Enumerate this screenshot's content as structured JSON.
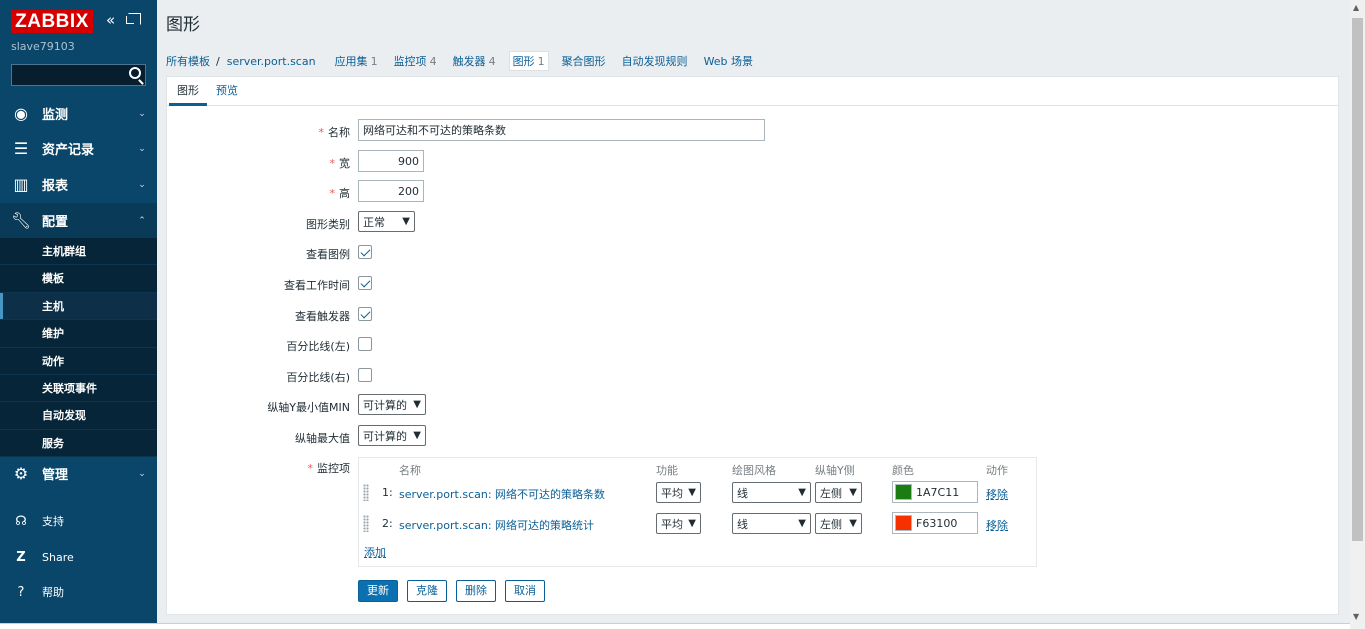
{
  "app": {
    "logo": "ZABBIX",
    "server_name": "slave79103"
  },
  "sidebar": {
    "search_placeholder": "",
    "menu": [
      {
        "label": "监测",
        "icon": "eye-icon"
      },
      {
        "label": "资产记录",
        "icon": "list-icon"
      },
      {
        "label": "报表",
        "icon": "bar-chart-icon"
      },
      {
        "label": "配置",
        "icon": "wrench-icon"
      }
    ],
    "config_submenu": [
      "主机群组",
      "模板",
      "主机",
      "维护",
      "动作",
      "关联项事件",
      "自动发现",
      "服务"
    ],
    "admin": {
      "label": "管理"
    },
    "support": "支持",
    "share": "Share",
    "help": "帮助"
  },
  "page": {
    "title": "图形"
  },
  "breadcrumbs": {
    "all_templates": "所有模板",
    "separator": "/",
    "host": "server.port.scan",
    "tabs": [
      {
        "label": "应用集",
        "count": "1"
      },
      {
        "label": "监控项",
        "count": "4"
      },
      {
        "label": "触发器",
        "count": "4"
      },
      {
        "label": "图形",
        "count": "1"
      },
      {
        "label": "聚合图形",
        "count": ""
      },
      {
        "label": "自动发现规则",
        "count": ""
      },
      {
        "label": "Web 场景",
        "count": ""
      }
    ]
  },
  "form_tabs": {
    "graph": "图形",
    "preview": "预览"
  },
  "form": {
    "name_label": "名称",
    "name_value": "网络可达和不可达的策略条数",
    "width_label": "宽",
    "width_value": "900",
    "height_label": "高",
    "height_value": "200",
    "graph_type_label": "图形类别",
    "graph_type_value": "正常",
    "show_legend_label": "查看图例",
    "show_working_time_label": "查看工作时间",
    "show_triggers_label": "查看触发器",
    "percentile_left_label": "百分比线(左)",
    "percentile_right_label": "百分比线(右)",
    "ymin_label": "纵轴Y最小值MIN",
    "ymin_value": "可计算的",
    "ymax_label": "纵轴最大值",
    "ymax_value": "可计算的",
    "items_label": "监控项",
    "required_mark": "*"
  },
  "items_table": {
    "headers": {
      "name": "名称",
      "function": "功能",
      "draw_style": "绘图风格",
      "y_axis": "纵轴Y侧",
      "color": "颜色",
      "action": "动作"
    },
    "rows": [
      {
        "num": "1:",
        "name": "server.port.scan: 网络不可达的策略条数",
        "function": "平均",
        "draw_style": "线",
        "y_axis": "左侧",
        "color": "1A7C11",
        "action": "移除"
      },
      {
        "num": "2:",
        "name": "server.port.scan: 网络可达的策略统计",
        "function": "平均",
        "draw_style": "线",
        "y_axis": "左侧",
        "color": "F63100",
        "action": "移除"
      }
    ],
    "add_label": "添加"
  },
  "buttons": {
    "update": "更新",
    "clone": "克隆",
    "delete": "删除",
    "cancel": "取消"
  },
  "colors": {
    "sidebar_bg": "#0a466a",
    "logo_bg": "#d40000",
    "link": "#0a5f96",
    "primary_btn": "#0a70b0",
    "series1": "#1A7C11",
    "series2": "#F63100"
  }
}
